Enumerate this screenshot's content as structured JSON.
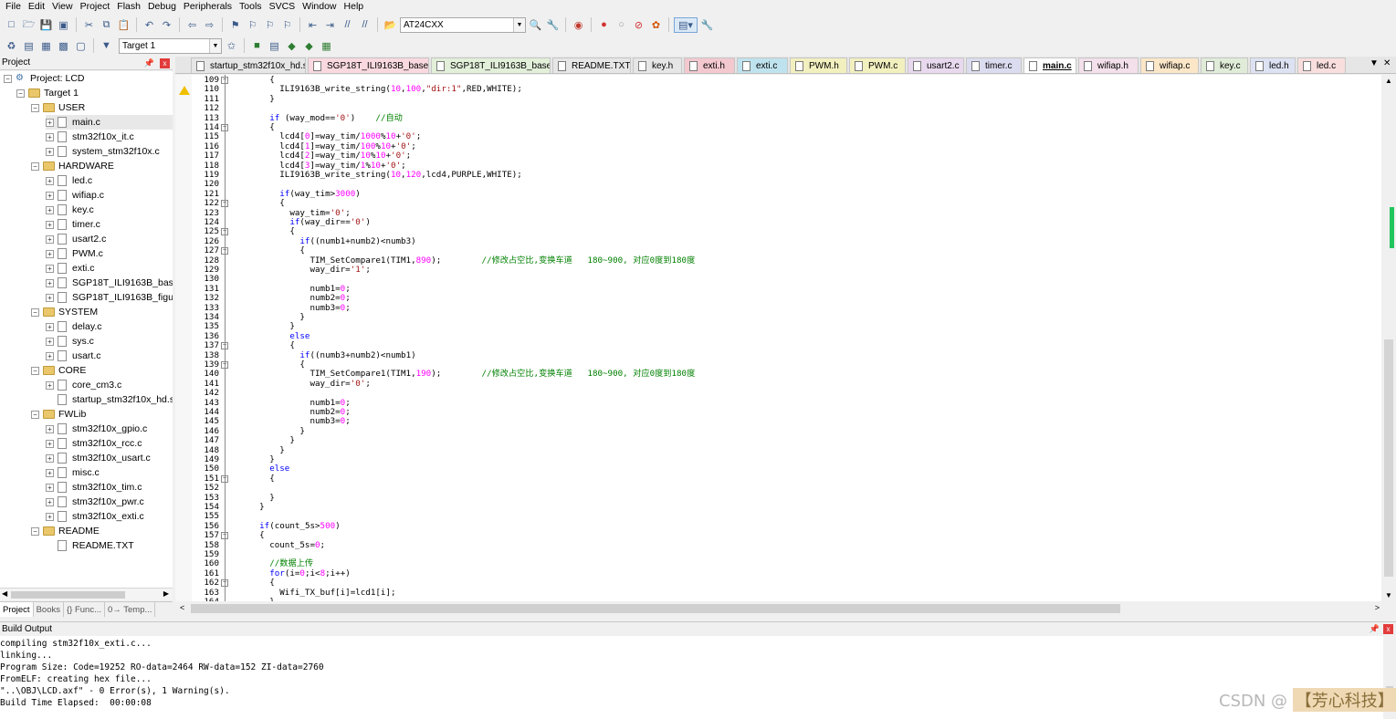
{
  "menu": [
    "File",
    "Edit",
    "View",
    "Project",
    "Flash",
    "Debug",
    "Peripherals",
    "Tools",
    "SVCS",
    "Window",
    "Help"
  ],
  "toolbar": {
    "target_combo": "AT24CXX",
    "target_select": "Target 1"
  },
  "project_panel": {
    "title": "Project",
    "tree": [
      {
        "label": "Project: LCD",
        "level": 0,
        "type": "project",
        "expanded": true
      },
      {
        "label": "Target 1",
        "level": 1,
        "type": "target",
        "expanded": true
      },
      {
        "label": "USER",
        "level": 2,
        "type": "folder",
        "expanded": true
      },
      {
        "label": "main.c",
        "level": 3,
        "type": "file",
        "selected": true
      },
      {
        "label": "stm32f10x_it.c",
        "level": 3,
        "type": "file"
      },
      {
        "label": "system_stm32f10x.c",
        "level": 3,
        "type": "file"
      },
      {
        "label": "HARDWARE",
        "level": 2,
        "type": "folder",
        "expanded": true
      },
      {
        "label": "led.c",
        "level": 3,
        "type": "file"
      },
      {
        "label": "wifiap.c",
        "level": 3,
        "type": "file"
      },
      {
        "label": "key.c",
        "level": 3,
        "type": "file"
      },
      {
        "label": "timer.c",
        "level": 3,
        "type": "file"
      },
      {
        "label": "usart2.c",
        "level": 3,
        "type": "file"
      },
      {
        "label": "PWM.c",
        "level": 3,
        "type": "file"
      },
      {
        "label": "exti.c",
        "level": 3,
        "type": "file"
      },
      {
        "label": "SGP18T_ILI9163B_base.c",
        "level": 3,
        "type": "file"
      },
      {
        "label": "SGP18T_ILI9163B_figure.c",
        "level": 3,
        "type": "file"
      },
      {
        "label": "SYSTEM",
        "level": 2,
        "type": "folder",
        "expanded": true
      },
      {
        "label": "delay.c",
        "level": 3,
        "type": "file"
      },
      {
        "label": "sys.c",
        "level": 3,
        "type": "file"
      },
      {
        "label": "usart.c",
        "level": 3,
        "type": "file"
      },
      {
        "label": "CORE",
        "level": 2,
        "type": "folder",
        "expanded": true
      },
      {
        "label": "core_cm3.c",
        "level": 3,
        "type": "file"
      },
      {
        "label": "startup_stm32f10x_hd.s",
        "level": 3,
        "type": "file",
        "noexp": true
      },
      {
        "label": "FWLib",
        "level": 2,
        "type": "folder",
        "expanded": true
      },
      {
        "label": "stm32f10x_gpio.c",
        "level": 3,
        "type": "file"
      },
      {
        "label": "stm32f10x_rcc.c",
        "level": 3,
        "type": "file"
      },
      {
        "label": "stm32f10x_usart.c",
        "level": 3,
        "type": "file"
      },
      {
        "label": "misc.c",
        "level": 3,
        "type": "file"
      },
      {
        "label": "stm32f10x_tim.c",
        "level": 3,
        "type": "file"
      },
      {
        "label": "stm32f10x_pwr.c",
        "level": 3,
        "type": "file"
      },
      {
        "label": "stm32f10x_exti.c",
        "level": 3,
        "type": "file"
      },
      {
        "label": "README",
        "level": 2,
        "type": "folder",
        "expanded": true
      },
      {
        "label": "README.TXT",
        "level": 3,
        "type": "file",
        "noexp": true
      }
    ],
    "tabs": [
      "Project",
      "Books",
      "{} Func...",
      "0→ Temp..."
    ]
  },
  "editor_tabs": [
    {
      "label": "startup_stm32f10x_hd.s",
      "color": "#e6e6e6"
    },
    {
      "label": "SGP18T_ILI9163B_base.h",
      "color": "#f9d9df"
    },
    {
      "label": "SGP18T_ILI9163B_base.c",
      "color": "#e2efd9"
    },
    {
      "label": "README.TXT",
      "color": "#e6e6e6"
    },
    {
      "label": "key.h",
      "color": "#e6e6e6"
    },
    {
      "label": "exti.h",
      "color": "#f3c8cf"
    },
    {
      "label": "exti.c",
      "color": "#bfe3ee"
    },
    {
      "label": "PWM.h",
      "color": "#f3f0c0"
    },
    {
      "label": "PWM.c",
      "color": "#f3f0c0"
    },
    {
      "label": "usart2.c",
      "color": "#e8d9ee"
    },
    {
      "label": "timer.c",
      "color": "#dcdcf0"
    },
    {
      "label": "main.c",
      "color": "#ffffff",
      "active": true
    },
    {
      "label": "wifiap.h",
      "color": "#f3e0ea"
    },
    {
      "label": "wifiap.c",
      "color": "#fbe6c8"
    },
    {
      "label": "key.c",
      "color": "#e0ecd8"
    },
    {
      "label": "led.h",
      "color": "#dde2f3"
    },
    {
      "label": "led.c",
      "color": "#f9dede"
    }
  ],
  "code_lines": [
    {
      "n": 109,
      "fold": "-",
      "t": [
        [
          "      {",
          ""
        ]
      ]
    },
    {
      "n": 110,
      "t": [
        [
          "        ILI9163B_write_string(",
          ""
        ],
        [
          "10",
          "num"
        ],
        [
          ",",
          ""
        ],
        [
          "100",
          "num"
        ],
        [
          ",",
          ""
        ],
        [
          "\"dir:1\"",
          "str"
        ],
        [
          ",RED,WHITE);",
          ""
        ]
      ]
    },
    {
      "n": 111,
      "t": [
        [
          "      }",
          ""
        ]
      ]
    },
    {
      "n": 112,
      "t": [
        [
          "",
          ""
        ]
      ]
    },
    {
      "n": 113,
      "t": [
        [
          "      ",
          "",
          ""
        ],
        [
          "if",
          "kw"
        ],
        [
          " (way_mod==",
          ""
        ],
        [
          "'0'",
          "str"
        ],
        [
          ")    ",
          ""
        ],
        [
          "//自动",
          "cmt"
        ]
      ]
    },
    {
      "n": 114,
      "fold": "-",
      "t": [
        [
          "      {",
          ""
        ]
      ]
    },
    {
      "n": 115,
      "t": [
        [
          "        lcd4[",
          ""
        ],
        [
          "0",
          "num"
        ],
        [
          "]=way_tim/",
          ""
        ],
        [
          "1000",
          "num"
        ],
        [
          "%",
          ""
        ],
        [
          "10",
          "num"
        ],
        [
          "+",
          ""
        ],
        [
          "'0'",
          "str"
        ],
        [
          ";",
          ""
        ]
      ]
    },
    {
      "n": 116,
      "t": [
        [
          "        lcd4[",
          ""
        ],
        [
          "1",
          "num"
        ],
        [
          "]=way_tim/",
          ""
        ],
        [
          "100",
          "num"
        ],
        [
          "%",
          ""
        ],
        [
          "10",
          "num"
        ],
        [
          "+",
          ""
        ],
        [
          "'0'",
          "str"
        ],
        [
          ";",
          ""
        ]
      ]
    },
    {
      "n": 117,
      "t": [
        [
          "        lcd4[",
          ""
        ],
        [
          "2",
          "num"
        ],
        [
          "]=way_tim/",
          ""
        ],
        [
          "10",
          "num"
        ],
        [
          "%",
          ""
        ],
        [
          "10",
          "num"
        ],
        [
          "+",
          ""
        ],
        [
          "'0'",
          "str"
        ],
        [
          ";",
          ""
        ]
      ]
    },
    {
      "n": 118,
      "t": [
        [
          "        lcd4[",
          ""
        ],
        [
          "3",
          "num"
        ],
        [
          "]=way_tim/",
          ""
        ],
        [
          "1",
          "num"
        ],
        [
          "%",
          ""
        ],
        [
          "10",
          "num"
        ],
        [
          "+",
          ""
        ],
        [
          "'0'",
          "str"
        ],
        [
          ";",
          ""
        ]
      ]
    },
    {
      "n": 119,
      "t": [
        [
          "        ILI9163B_write_string(",
          ""
        ],
        [
          "10",
          "num"
        ],
        [
          ",",
          ""
        ],
        [
          "120",
          "num"
        ],
        [
          ",lcd4,PURPLE,WHITE);",
          ""
        ]
      ]
    },
    {
      "n": 120,
      "t": [
        [
          "",
          ""
        ]
      ]
    },
    {
      "n": 121,
      "t": [
        [
          "        ",
          ""
        ],
        [
          "if",
          "kw"
        ],
        [
          "(way_tim>",
          ""
        ],
        [
          "3000",
          "num"
        ],
        [
          ")",
          ""
        ]
      ]
    },
    {
      "n": 122,
      "fold": "-",
      "t": [
        [
          "        {",
          ""
        ]
      ]
    },
    {
      "n": 123,
      "t": [
        [
          "          way_tim=",
          ""
        ],
        [
          "'0'",
          "str"
        ],
        [
          ";",
          ""
        ]
      ]
    },
    {
      "n": 124,
      "t": [
        [
          "          ",
          ""
        ],
        [
          "if",
          "kw"
        ],
        [
          "(way_dir==",
          ""
        ],
        [
          "'0'",
          "str"
        ],
        [
          ")",
          ""
        ]
      ]
    },
    {
      "n": 125,
      "fold": "-",
      "t": [
        [
          "          {",
          ""
        ]
      ]
    },
    {
      "n": 126,
      "t": [
        [
          "            ",
          ""
        ],
        [
          "if",
          "kw"
        ],
        [
          "((numb1+numb2)<numb3)",
          ""
        ]
      ]
    },
    {
      "n": 127,
      "fold": "-",
      "t": [
        [
          "            {",
          ""
        ]
      ]
    },
    {
      "n": 128,
      "t": [
        [
          "              TIM_SetCompare1(TIM1,",
          ""
        ],
        [
          "890",
          "num"
        ],
        [
          ");        ",
          ""
        ],
        [
          "//修改占空比,变换车道   180~900, 对应0度到180度",
          "cmt"
        ]
      ]
    },
    {
      "n": 129,
      "t": [
        [
          "              way_dir=",
          ""
        ],
        [
          "'1'",
          "str"
        ],
        [
          ";",
          ""
        ]
      ]
    },
    {
      "n": 130,
      "t": [
        [
          "",
          ""
        ]
      ]
    },
    {
      "n": 131,
      "t": [
        [
          "              numb1=",
          ""
        ],
        [
          "0",
          "num"
        ],
        [
          ";",
          ""
        ]
      ]
    },
    {
      "n": 132,
      "t": [
        [
          "              numb2=",
          ""
        ],
        [
          "0",
          "num"
        ],
        [
          ";",
          ""
        ]
      ]
    },
    {
      "n": 133,
      "t": [
        [
          "              numb3=",
          ""
        ],
        [
          "0",
          "num"
        ],
        [
          ";",
          ""
        ]
      ]
    },
    {
      "n": 134,
      "t": [
        [
          "            }",
          ""
        ]
      ]
    },
    {
      "n": 135,
      "t": [
        [
          "          }",
          ""
        ]
      ]
    },
    {
      "n": 136,
      "t": [
        [
          "          ",
          ""
        ],
        [
          "else",
          "kw"
        ]
      ]
    },
    {
      "n": 137,
      "fold": "-",
      "t": [
        [
          "          {",
          ""
        ]
      ]
    },
    {
      "n": 138,
      "t": [
        [
          "            ",
          ""
        ],
        [
          "if",
          "kw"
        ],
        [
          "((numb3+numb2)<numb1)",
          ""
        ]
      ]
    },
    {
      "n": 139,
      "fold": "-",
      "t": [
        [
          "            {",
          ""
        ]
      ]
    },
    {
      "n": 140,
      "t": [
        [
          "              TIM_SetCompare1(TIM1,",
          ""
        ],
        [
          "190",
          "num"
        ],
        [
          ");        ",
          ""
        ],
        [
          "//修改占空比,变换车道   180~900, 对应0度到180度",
          "cmt"
        ]
      ]
    },
    {
      "n": 141,
      "t": [
        [
          "              way_dir=",
          ""
        ],
        [
          "'0'",
          "str"
        ],
        [
          ";",
          ""
        ]
      ]
    },
    {
      "n": 142,
      "t": [
        [
          "",
          ""
        ]
      ]
    },
    {
      "n": 143,
      "t": [
        [
          "              numb1=",
          ""
        ],
        [
          "0",
          "num"
        ],
        [
          ";",
          ""
        ]
      ]
    },
    {
      "n": 144,
      "t": [
        [
          "              numb2=",
          ""
        ],
        [
          "0",
          "num"
        ],
        [
          ";",
          ""
        ]
      ]
    },
    {
      "n": 145,
      "t": [
        [
          "              numb3=",
          ""
        ],
        [
          "0",
          "num"
        ],
        [
          ";",
          ""
        ]
      ]
    },
    {
      "n": 146,
      "t": [
        [
          "            }",
          ""
        ]
      ]
    },
    {
      "n": 147,
      "t": [
        [
          "          }",
          ""
        ]
      ]
    },
    {
      "n": 148,
      "t": [
        [
          "        }",
          ""
        ]
      ]
    },
    {
      "n": 149,
      "t": [
        [
          "      }",
          ""
        ]
      ]
    },
    {
      "n": 150,
      "t": [
        [
          "      ",
          ""
        ],
        [
          "else",
          "kw"
        ]
      ]
    },
    {
      "n": 151,
      "fold": "-",
      "t": [
        [
          "      {",
          ""
        ]
      ]
    },
    {
      "n": 152,
      "t": [
        [
          "",
          ""
        ]
      ]
    },
    {
      "n": 153,
      "t": [
        [
          "      }",
          ""
        ]
      ]
    },
    {
      "n": 154,
      "t": [
        [
          "    }",
          ""
        ]
      ]
    },
    {
      "n": 155,
      "t": [
        [
          "",
          ""
        ]
      ]
    },
    {
      "n": 156,
      "t": [
        [
          "    ",
          ""
        ],
        [
          "if",
          "kw"
        ],
        [
          "(count_5s>",
          ""
        ],
        [
          "500",
          "num"
        ],
        [
          ")",
          ""
        ]
      ]
    },
    {
      "n": 157,
      "fold": "-",
      "t": [
        [
          "    {",
          ""
        ]
      ]
    },
    {
      "n": 158,
      "t": [
        [
          "      count_5s=",
          ""
        ],
        [
          "0",
          "num"
        ],
        [
          ";",
          ""
        ]
      ]
    },
    {
      "n": 159,
      "t": [
        [
          "",
          ""
        ]
      ]
    },
    {
      "n": 160,
      "t": [
        [
          "      ",
          ""
        ],
        [
          "//数据上传",
          "cmt"
        ]
      ]
    },
    {
      "n": 161,
      "t": [
        [
          "      ",
          ""
        ],
        [
          "for",
          "kw"
        ],
        [
          "(i=",
          ""
        ],
        [
          "0",
          "num"
        ],
        [
          ";i<",
          ""
        ],
        [
          "8",
          "num"
        ],
        [
          ";i++)",
          ""
        ]
      ]
    },
    {
      "n": 162,
      "fold": "-",
      "t": [
        [
          "      {",
          ""
        ]
      ]
    },
    {
      "n": 163,
      "t": [
        [
          "        Wifi_TX_buf[i]=lcd1[i];",
          ""
        ]
      ]
    },
    {
      "n": 164,
      "t": [
        [
          "      }",
          ""
        ]
      ]
    }
  ],
  "build_output": {
    "title": "Build Output",
    "lines": [
      "compiling stm32f10x_exti.c...",
      "linking...",
      "Program Size: Code=19252 RO-data=2464 RW-data=152 ZI-data=2760",
      "FromELF: creating hex file...",
      "\"..\\OBJ\\LCD.axf\" - 0 Error(s), 1 Warning(s).",
      "Build Time Elapsed:  00:00:08"
    ]
  },
  "watermark": {
    "text": "CSDN @",
    "logo": "【芳心科技】"
  }
}
